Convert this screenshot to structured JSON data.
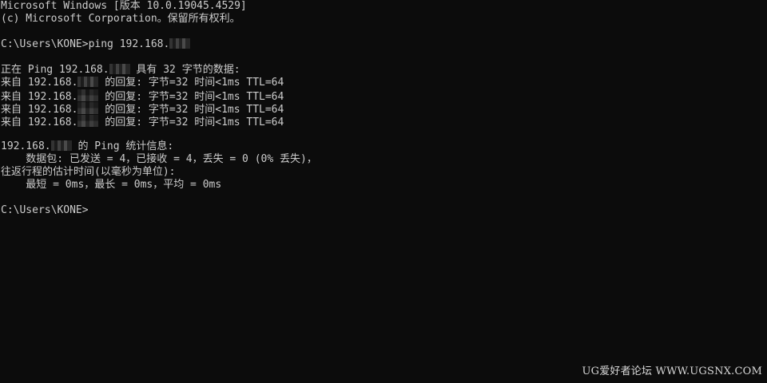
{
  "terminal": {
    "lines": {
      "l01": "Microsoft Windows [版本 10.0.19045.4529]",
      "l02": "(c) Microsoft Corporation。保留所有权利。",
      "l04_prefix": "C:\\Users\\KONE>ping 192.168.",
      "l06_prefix": "正在 Ping 192.168.",
      "l06_suffix": " 具有 32 字节的数据:",
      "reply_prefix": "来自 192.168.",
      "reply_suffix": " 的回复: 字节=32 时间<1ms TTL=64",
      "stats_prefix": "192.168.",
      "stats_suffix": " 的 Ping 统计信息:",
      "packets": "    数据包: 已发送 = 4，已接收 = 4，丢失 = 0 (0% 丢失)，",
      "rtt_header": "往返行程的估计时间(以毫秒为单位):",
      "rtt_values": "    最短 = 0ms，最长 = 0ms，平均 = 0ms",
      "prompt": "C:\\Users\\KONE>"
    }
  },
  "watermark": {
    "text": "UG爱好者论坛 WWW.UGSNX.COM"
  },
  "colors": {
    "background": "#0c0c0c",
    "text": "#cccccc"
  }
}
